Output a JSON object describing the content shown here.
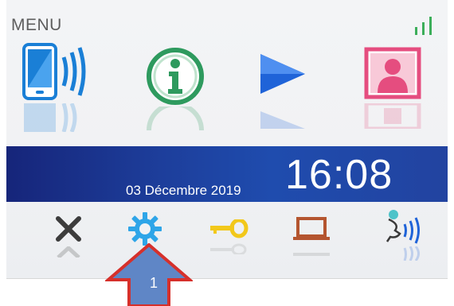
{
  "screen": {
    "menu_title": "MENU",
    "date": "03 Décembre 2019",
    "time": "16:08"
  },
  "top_icons": [
    {
      "name": "phone-wireless-icon"
    },
    {
      "name": "info-icon"
    },
    {
      "name": "play-icon"
    },
    {
      "name": "contact-icon"
    }
  ],
  "bottom_icons": [
    {
      "name": "close-icon"
    },
    {
      "name": "settings-icon"
    },
    {
      "name": "key-icon"
    },
    {
      "name": "laptop-icon"
    },
    {
      "name": "voice-command-icon"
    }
  ],
  "annotation": {
    "label": "1"
  },
  "colors": {
    "time_bar": "#1d3e9b",
    "phone_blue": "#1a7fd6",
    "info_green": "#2e9a5e",
    "play_blue": "#1f63d8",
    "contact_pink": "#e54d7f",
    "settings_blue": "#2ea5e8",
    "key_yellow": "#f2c81b",
    "laptop_brown": "#b4552f",
    "arrow_red": "#d6302b",
    "arrow_fill": "#5f86c6",
    "signal_green": "#3cae5a"
  }
}
